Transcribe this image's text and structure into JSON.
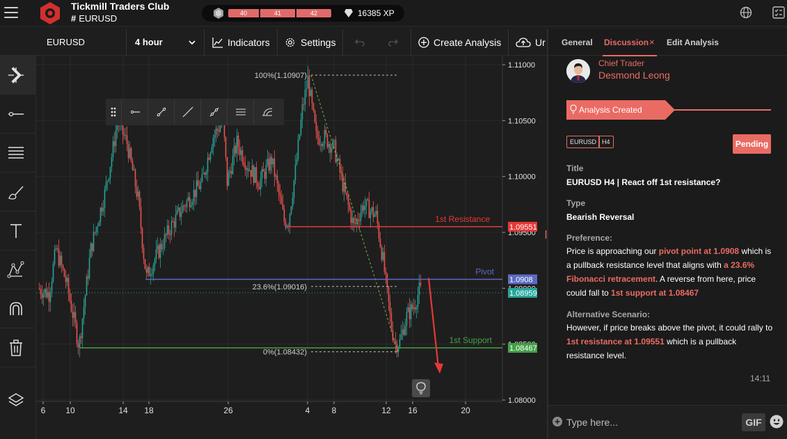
{
  "app": {
    "title": "Tickmill Traders Club",
    "channel": "EURUSD",
    "xp_levels": [
      "40",
      "41",
      "42"
    ],
    "xp_value": "16385 XP",
    "brand_color": "#ea6b63"
  },
  "toolbar": {
    "symbol": "EURUSD",
    "interval": "4 hour",
    "indicators_label": "Indicators",
    "settings_label": "Settings",
    "create_label": "Create Analysis",
    "upload_label": "Ur"
  },
  "chart": {
    "price_labels": [
      "1.11000",
      "1.10500",
      "1.10000",
      "1.09500",
      "1.09000",
      "1.08500",
      "1.08000"
    ],
    "date_labels": [
      "6",
      "10",
      "14",
      "18",
      "26",
      "4",
      "8",
      "12",
      "16",
      "20"
    ],
    "fib_labels": [
      "100%(1.10907)",
      "23.6%(1.09016)",
      "0%(1.08432)"
    ],
    "levels": {
      "resistance_label": "1st Resistance",
      "resistance_price": "1.09551",
      "pivot_label": "Pivot",
      "pivot_price": "1.0908",
      "last_price": "1.08959",
      "support_label": "1st Support",
      "support_price": "1.08467"
    },
    "colors": {
      "up": "#26a69a",
      "down": "#ef5350",
      "resistance": "#e53935",
      "pivot": "#5c6bc0",
      "support": "#43a047"
    }
  },
  "panel": {
    "tabs": [
      "General",
      "Discussion",
      "Edit Analysis"
    ],
    "author_role": "Chief Trader",
    "author_name": "Desmond Leong",
    "status": "Analysis Created",
    "tag_symbol": "EURUSD",
    "tag_tf": "H4",
    "pending": "Pending",
    "title_label": "Title",
    "title_value": "EURUSD H4 | React off 1st resistance?",
    "type_label": "Type",
    "type_value": "Bearish Reversal",
    "pref_label": "Preference:",
    "pref_1": "Price is approaching our ",
    "pref_2": "pivot point at 1.0908",
    "pref_3": " which is a pullback resistance level that aligns with ",
    "pref_4": "a 23.6% Fibonacci retracement",
    "pref_5": ". A reverse from here, price could fall to ",
    "pref_6": "1st support at 1.08467",
    "alt_label": "Alternative Scenario:",
    "alt_1": "However, if price breaks above the pivot, it could rally to ",
    "alt_2": "1st resistance at 1.09551",
    "alt_3": " which is a pullback resistance level.",
    "time": "14:11",
    "input_placeholder": "Type here...",
    "gif_label": "GIF"
  }
}
